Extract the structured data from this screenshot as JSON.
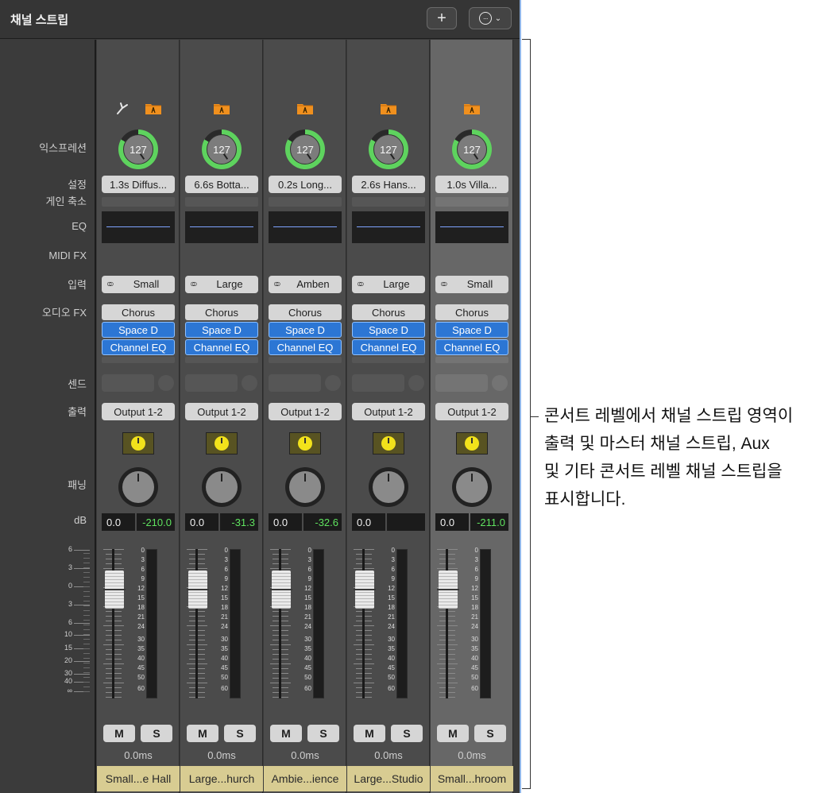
{
  "panel": {
    "title": "채널 스트립",
    "add_label": "+",
    "more_label": "···",
    "more_chevron": "⌄"
  },
  "row_labels": {
    "expression": "익스프레션",
    "setting": "설정",
    "gain": "게인 축소",
    "eq": "EQ",
    "midi_fx": "MIDI FX",
    "input": "입력",
    "audio_fx": "오디오 FX",
    "sends": "센드",
    "output": "출력",
    "pan": "패닝",
    "db": "dB"
  },
  "main_scale": [
    "6",
    "3",
    "0",
    "3",
    "6",
    "10",
    "15",
    "20",
    "30",
    "40",
    "∞"
  ],
  "meter_scale": [
    "0",
    "3",
    "6",
    "9",
    "12",
    "15",
    "18",
    "21",
    "24",
    "30",
    "35",
    "40",
    "45",
    "50",
    "60"
  ],
  "strips": [
    {
      "has_tuning_icon": true,
      "expression": "127",
      "setting": "1.3s Diffus...",
      "input": "Small",
      "fx": [
        "Chorus",
        "Space D",
        "Channel EQ"
      ],
      "output": "Output 1-2",
      "volume": "0.0",
      "peak": "-210.0",
      "mute": "M",
      "solo": "S",
      "latency": "0.0ms",
      "name": "Small...e Hall",
      "selected": false
    },
    {
      "has_tuning_icon": false,
      "expression": "127",
      "setting": "6.6s Botta...",
      "input": "Large",
      "fx": [
        "Chorus",
        "Space D",
        "Channel EQ"
      ],
      "output": "Output 1-2",
      "volume": "0.0",
      "peak": "-31.3",
      "mute": "M",
      "solo": "S",
      "latency": "0.0ms",
      "name": "Large...hurch",
      "selected": false
    },
    {
      "has_tuning_icon": false,
      "expression": "127",
      "setting": "0.2s Long...",
      "input": "Amben",
      "fx": [
        "Chorus",
        "Space D",
        "Channel EQ"
      ],
      "output": "Output 1-2",
      "volume": "0.0",
      "peak": "-32.6",
      "mute": "M",
      "solo": "S",
      "latency": "0.0ms",
      "name": "Ambie...ience",
      "selected": false
    },
    {
      "has_tuning_icon": false,
      "expression": "127",
      "setting": "2.6s Hans...",
      "input": "Large",
      "fx": [
        "Chorus",
        "Space D",
        "Channel EQ"
      ],
      "output": "Output 1-2",
      "volume": "0.0",
      "peak": "",
      "mute": "M",
      "solo": "S",
      "latency": "0.0ms",
      "name": "Large...Studio",
      "selected": false
    },
    {
      "has_tuning_icon": false,
      "expression": "127",
      "setting": "1.0s Villa...",
      "input": "Small",
      "fx": [
        "Chorus",
        "Space D",
        "Channel EQ"
      ],
      "output": "Output 1-2",
      "volume": "0.0",
      "peak": "-211.0",
      "mute": "M",
      "solo": "S",
      "latency": "0.0ms",
      "name": "Small...hroom",
      "selected": true
    }
  ],
  "callout": {
    "lines": [
      "콘서트 레벨에서 채널 스트립 영역이",
      "출력 및 마스터 채널 스트립, Aux",
      "및 기타 콘서트 레벨 채널 스트립을",
      "표시합니다."
    ]
  },
  "colors": {
    "panel_bg": "#3a3a3a",
    "strip_bg": "#4b4b4b",
    "selected_strip_bg": "#676767",
    "fx_active": "#2c76d4",
    "expression_ring": "#5ed35e",
    "name_bar": "#d8cc92",
    "folder": "#f0901e",
    "peak_text": "#5fe35f"
  },
  "icons": {
    "tuning": "tuning-fork-icon",
    "folder": "folder-icon",
    "add": "plus-icon",
    "more": "ellipsis-circle-icon",
    "link": "stereo-link-icon"
  }
}
